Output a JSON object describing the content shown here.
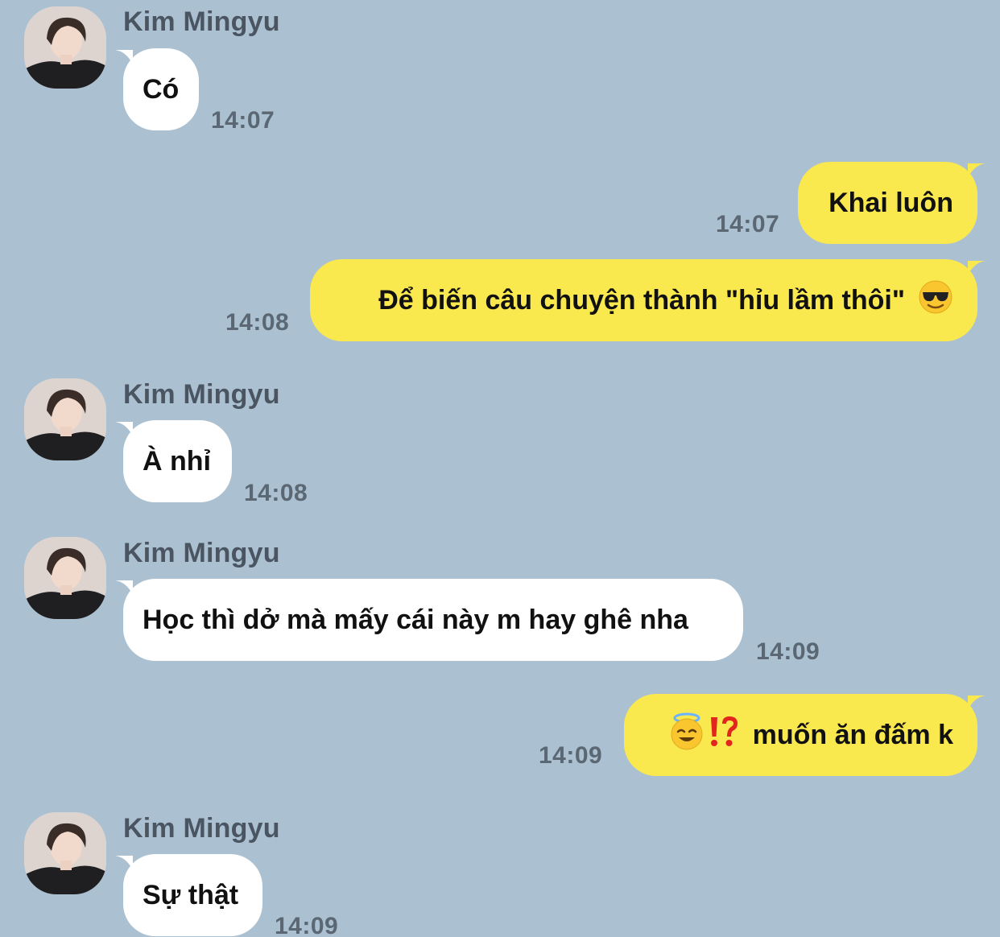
{
  "contact": {
    "name": "Kim Mingyu"
  },
  "colors": {
    "background": "#abc1d1",
    "incoming": "#ffffff",
    "outgoing": "#fae84f"
  },
  "messages": [
    {
      "sender": "Kim Mingyu",
      "direction": "incoming",
      "text": "Có",
      "time": "14:07"
    },
    {
      "sender": "me",
      "direction": "outgoing",
      "text": "Khai luôn",
      "time": "14:07"
    },
    {
      "sender": "me",
      "direction": "outgoing",
      "text": "Để biến câu chuyện thành \"hỉu lầm thôi\"",
      "emoji": "sunglasses-face",
      "time": "14:08"
    },
    {
      "sender": "Kim Mingyu",
      "direction": "incoming",
      "text": "À nhỉ",
      "time": "14:08"
    },
    {
      "sender": "Kim Mingyu",
      "direction": "incoming",
      "text": "Học thì dở mà mấy cái này m hay ghê nha",
      "time": "14:09"
    },
    {
      "sender": "me",
      "direction": "outgoing",
      "emoji": "halo-smile-face, exclamation-question-mark",
      "text": "muốn ăn đấm k",
      "time": "14:09"
    },
    {
      "sender": "Kim Mingyu",
      "direction": "incoming",
      "text": "Sự thật",
      "time": "14:09"
    }
  ]
}
